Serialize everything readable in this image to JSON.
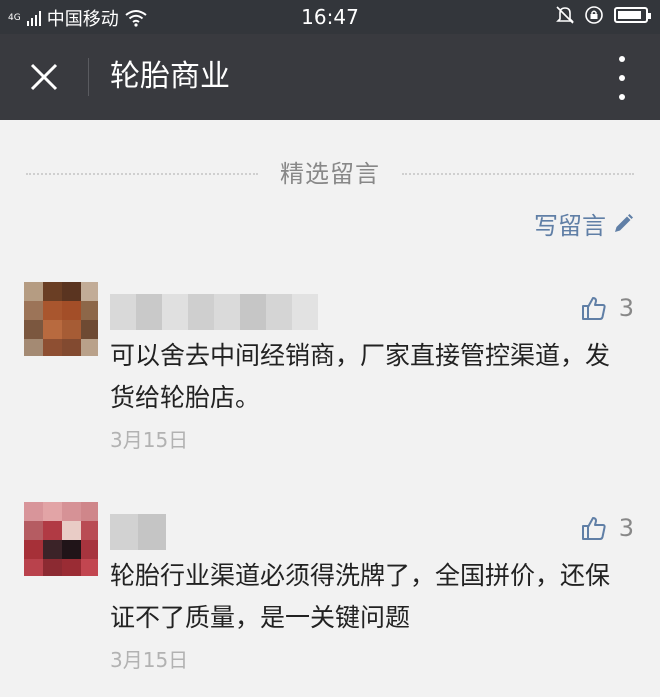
{
  "status_bar": {
    "network_badge": "4G",
    "carrier": "中国移动",
    "time": "16:47",
    "battery_level": 0.9,
    "icons": [
      "signal-icon",
      "wifi-icon",
      "mute-icon",
      "rotation-lock-icon",
      "battery-icon"
    ]
  },
  "nav": {
    "close_icon": "close-icon",
    "title": "轮胎商业",
    "more_icon": "more-vertical-icon"
  },
  "section": {
    "title": "精选留言",
    "write_label": "写留言",
    "write_icon": "pencil-icon"
  },
  "comments": [
    {
      "nickname_blurred": true,
      "text": "可以舍去中间经销商，厂家直接管控渠道，发货给轮胎店。",
      "date": "3月15日",
      "likes": "3",
      "like_icon": "thumbs-up-icon"
    },
    {
      "nickname_blurred": true,
      "text": "轮胎行业渠道必须得洗牌了，全国拼价，还保证不了质量，是一关键问题",
      "date": "3月15日",
      "likes": "3",
      "like_icon": "thumbs-up-icon"
    }
  ],
  "colors": {
    "status_bar": "#33363b",
    "nav_bar": "#393a3f",
    "background": "#f2f2f2",
    "link": "#607fa6",
    "meta": "#b2b2b2"
  }
}
